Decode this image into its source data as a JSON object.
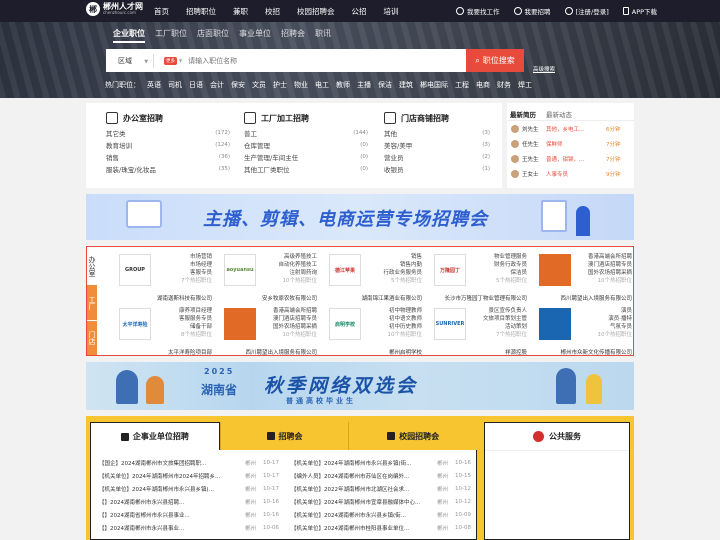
{
  "brand": {
    "name": "郴州人才网",
    "sub": "chenzhourc.com"
  },
  "nav": {
    "links": [
      "首页",
      "招聘职位",
      "兼职",
      "校招",
      "校园招聘会",
      "公招",
      "培训"
    ]
  },
  "nav_right": {
    "find_job": "我要找工作",
    "recruit": "我要招聘",
    "login": "[注册/登录]",
    "app": "APP下载"
  },
  "hero": {
    "tabs": [
      "企业职位",
      "工厂职位",
      "店面职位",
      "事业单位",
      "招聘会",
      "职讯"
    ],
    "region": "区域",
    "more": "更多",
    "placeholder": "请输入职位名称",
    "search_btn": "职位搜索",
    "adv": "高级搜索",
    "hot_label": "热门职位：",
    "hot": [
      "英语",
      "司机",
      "日语",
      "会计",
      "保安",
      "文员",
      "护士",
      "物业",
      "电工",
      "教师",
      "主播",
      "保洁",
      "建筑",
      "郴电国际",
      "工程",
      "电商",
      "财务",
      "焊工"
    ]
  },
  "categories": [
    {
      "title": "办公室招聘",
      "items": [
        [
          "其它类",
          "(172)"
        ],
        [
          "教育培训",
          "(124)"
        ],
        [
          "销售",
          "(36)"
        ],
        [
          "服装/珠宝/化妆品",
          "(35)"
        ]
      ]
    },
    {
      "title": "工厂加工招聘",
      "items": [
        [
          "普工",
          "(144)"
        ],
        [
          "仓库管理",
          "(0)"
        ],
        [
          "生产管理/车间主任",
          "(0)"
        ],
        [
          "其他工厂类职位",
          "(0)"
        ]
      ]
    },
    {
      "title": "门店商铺招聘",
      "items": [
        [
          "其他",
          "(3)"
        ],
        [
          "美容/美甲",
          "(3)"
        ],
        [
          "营业员",
          "(2)"
        ],
        [
          "收银员",
          "(1)"
        ]
      ]
    }
  ],
  "news": {
    "tabs": [
      "最新简历",
      "最新动态"
    ],
    "rows": [
      {
        "name": "刘先生",
        "job": "其他，乡电工...",
        "time": "6分钟"
      },
      {
        "name": "任先生",
        "job": "保鲜师",
        "time": "7分钟"
      },
      {
        "name": "王先生",
        "job": "普通，钳铆，...",
        "time": "7分钟"
      },
      {
        "name": "王女士",
        "job": "人事专员",
        "time": "9分钟"
      }
    ]
  },
  "banner1": {
    "text": "主播、剪辑、电商运营专场招聘会"
  },
  "comp_side": {
    "s1": "办公室",
    "s2": "工厂",
    "s3": "门店"
  },
  "companies": [
    {
      "logo": "GROUP",
      "jobs": [
        "市场营销",
        "市场经理",
        "客服专员"
      ],
      "count": "7个热招职位",
      "name": "湖南迦斯科技有限公司",
      "color": "#333"
    },
    {
      "logo": "aoyuansu",
      "jobs": [
        "高级养殖技工",
        "自动化养殖技工",
        "注射周药询"
      ],
      "count": "10个热招职位",
      "name": "安乡牧原农牧有限公司",
      "color": "#5a8a3a"
    },
    {
      "logo": "德江苹果",
      "jobs": [
        "销售",
        "销售内勤",
        "行政业务服务员"
      ],
      "count": "5个热招职位",
      "name": "湖南锦江果酒业有限公司",
      "color": "#c33"
    },
    {
      "logo": "万隆园丁",
      "jobs": [
        "物业管理服务",
        "财务行政专员",
        "保洁员"
      ],
      "count": "5个热招职位",
      "name": "长沙市万隆园丁物业管理有限公司",
      "color": "#c33"
    },
    {
      "logo": "",
      "jobs": [
        "香港高端会所招聘",
        "澳门酒店招聘专员",
        "国外农场招聘采摘"
      ],
      "count": "10个热招职位",
      "name": "西川聘望出入境服务有限公司",
      "color": "#e06a26"
    },
    {
      "logo": "太平洋寿险",
      "jobs": [
        "康养项目经理",
        "客服服务专员",
        "储备干部"
      ],
      "count": "8个热招职位",
      "name": "太平洋寿险项目部",
      "color": "#1b66b1"
    },
    {
      "logo": "",
      "jobs": [
        "香港高端会所招聘",
        "澳门酒店招聘专员",
        "国外农场招聘采摘"
      ],
      "count": "10个热招职位",
      "name": "西川聘望出入境服务有限公司",
      "color": "#e06a26"
    },
    {
      "logo": "启明学校",
      "jobs": [
        "初中物理教师",
        "初中语文教师",
        "初中历史教师"
      ],
      "count": "10个热招职位",
      "name": "郴州启明学校",
      "color": "#1b8c6a"
    },
    {
      "logo": "SUNRIVER",
      "jobs": [
        "景区宣传负责人",
        "文旅项目策划主管",
        "活动策划"
      ],
      "count": "7个热招职位",
      "name": "祥源控股",
      "color": "#1b66b1"
    },
    {
      "logo": "",
      "jobs": [
        "演员",
        "演员·播特",
        "气氛专员"
      ],
      "count": "10个热招职位",
      "name": "郴州市众新文化传播有限公司",
      "color": "#1b66b1"
    }
  ],
  "banner2": {
    "year": "2025",
    "prov": "湖南省",
    "title": "秋季网络双选会",
    "sub": "普通高校毕业生"
  },
  "bottom": {
    "tabs": [
      "企事业单位招聘",
      "招聘会",
      "校园招聘会"
    ],
    "left": [
      [
        "【国企】2024湖南郴州市文旅集团招聘职...",
        "郴州",
        "10-17"
      ],
      [
        "【机关单位】2024年湖南郴州市2024年招聘乡...",
        "郴州",
        "10-17"
      ],
      [
        "【机关单位】2024年湖南郴州市永兴县乡镇(...",
        "郴州",
        "10-17"
      ],
      [
        "【】2024湖南郴州市永兴县招聘...",
        "郴州",
        "10-16"
      ],
      [
        "【】2024湖南省郴州市永兴县事业...",
        "郴州",
        "10-16"
      ],
      [
        "【】2024湖南郴州市永兴县事业...",
        "郴州",
        "10-06"
      ]
    ],
    "right": [
      [
        "【机关单位】2024年湖南郴州市永兴县乡镇(街...",
        "郴州",
        "10-16"
      ],
      [
        "【编外人员】2024湖南郴州市苏仙区在岗编外...",
        "郴州",
        "10-15"
      ],
      [
        "【机关单位】2022年湖南郴州市北湖区社会求...",
        "郴州",
        "10-12"
      ],
      [
        "【机关单位】2024年湖南郴州市宜章县融媒体中心...",
        "郴州",
        "10-12"
      ],
      [
        "【机关单位】2024湖南郴州市永兴县乡镇(街...",
        "郴州",
        "10-09"
      ],
      [
        "【机关单位】2024湖南郴州市桂阳县事业单位...",
        "郴州",
        "10-08"
      ]
    ],
    "service": "公共服务"
  }
}
